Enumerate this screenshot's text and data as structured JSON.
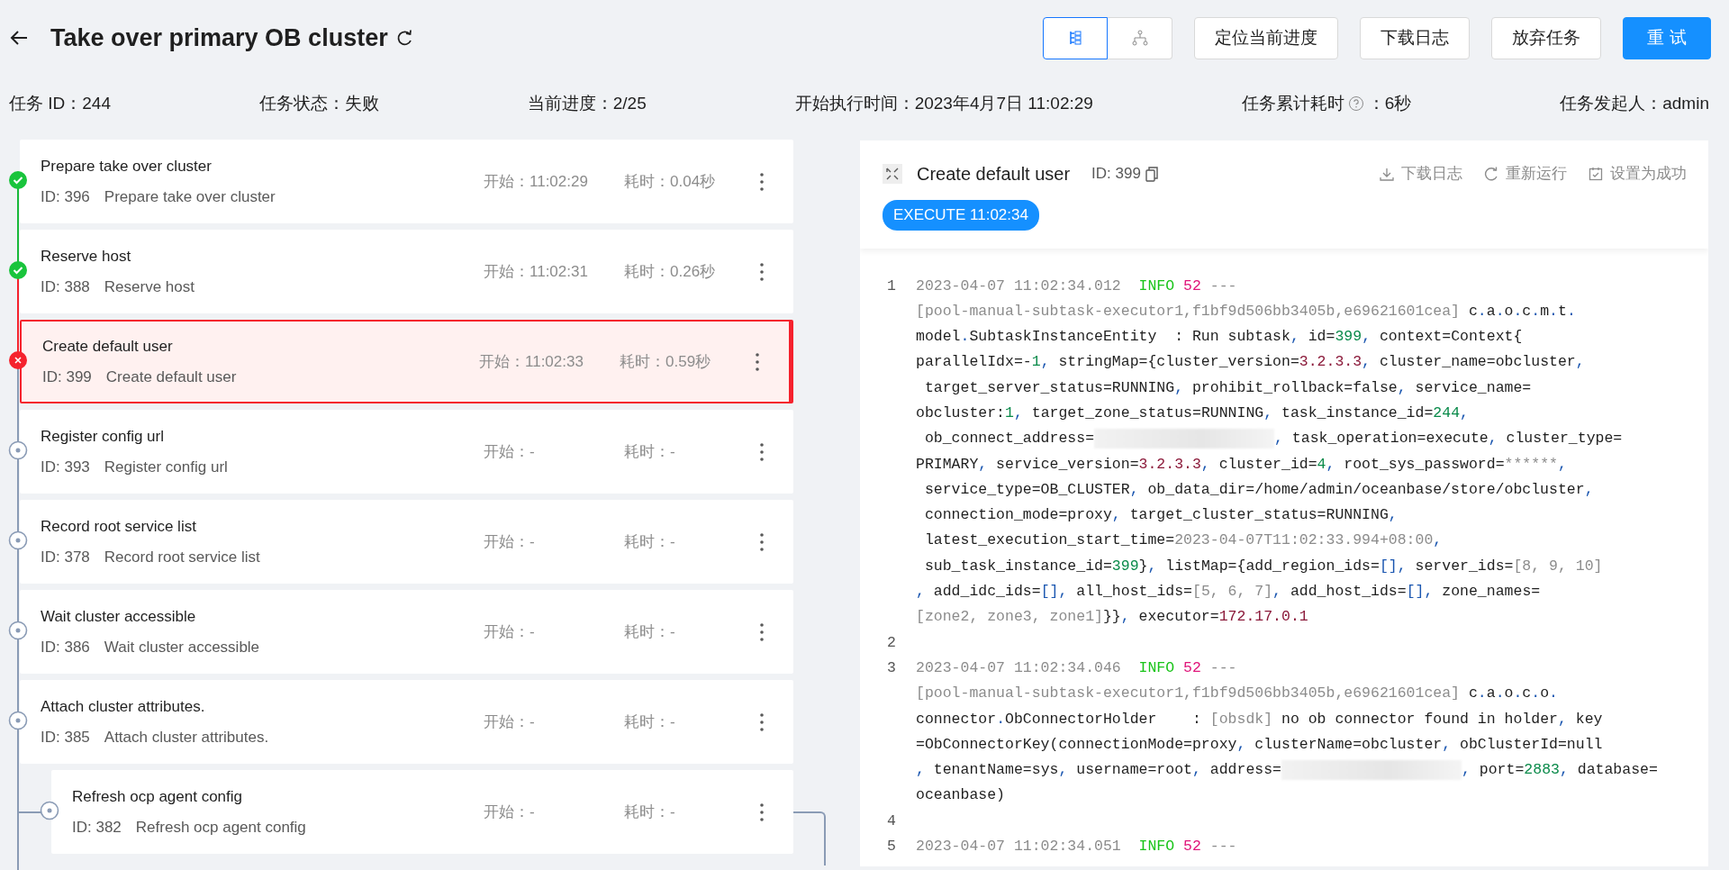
{
  "header": {
    "title": "Take over primary OB cluster",
    "view_toggle": [
      {
        "kind": "list",
        "selected": true
      },
      {
        "kind": "tree",
        "selected": false
      }
    ],
    "buttons": [
      {
        "label": "定位当前进度",
        "kind": "default"
      },
      {
        "label": "下载日志",
        "kind": "default"
      },
      {
        "label": "放弃任务",
        "kind": "default"
      },
      {
        "label": "重 试",
        "kind": "primary"
      }
    ]
  },
  "info": [
    {
      "text": "任务 ID：244",
      "help": false
    },
    {
      "text": "任务状态：失败",
      "help": false
    },
    {
      "text": "当前进度：2/25",
      "help": false
    },
    {
      "text": "开始执行时间：2023年4月7日 11:02:29",
      "help": false
    },
    {
      "text": "任务累计耗时",
      "help": true,
      "suffix": "：6秒"
    },
    {
      "text": "任务发起人：admin",
      "help": false
    }
  ],
  "tasks": [
    {
      "title": "Prepare take over cluster",
      "id": "ID: 396",
      "description": "Prepare take over cluster",
      "start": "开始：11:02:29",
      "duration": "耗时：0.04秒",
      "kind": "success",
      "selected": false
    },
    {
      "title": "Reserve host",
      "id": "ID: 388",
      "description": "Reserve host",
      "start": "开始：11:02:31",
      "duration": "耗时：0.26秒",
      "kind": "success",
      "selected": false
    },
    {
      "title": "Create default user",
      "id": "ID: 399",
      "description": "Create default user",
      "start": "开始：11:02:33",
      "duration": "耗时：0.59秒",
      "kind": "failed",
      "selected": true
    },
    {
      "title": "Register config url",
      "id": "ID: 393",
      "description": "Register config url",
      "start": "开始：-",
      "duration": "耗时：-",
      "kind": "pending",
      "selected": false
    },
    {
      "title": "Record root service list",
      "id": "ID: 378",
      "description": "Record root service list",
      "start": "开始：-",
      "duration": "耗时：-",
      "kind": "pending",
      "selected": false
    },
    {
      "title": "Wait cluster accessible",
      "id": "ID: 386",
      "description": "Wait cluster accessible",
      "start": "开始：-",
      "duration": "耗时：-",
      "kind": "pending",
      "selected": false
    },
    {
      "title": "Attach cluster attributes.",
      "id": "ID: 385",
      "description": "Attach cluster attributes.",
      "start": "开始：-",
      "duration": "耗时：-",
      "kind": "pending",
      "selected": false,
      "children": [
        {
          "title": "Refresh ocp agent config",
          "id": "ID: 382",
          "description": "Refresh ocp agent config",
          "start": "开始：-",
          "duration": "耗时：-",
          "kind": "pending",
          "selected": false
        }
      ]
    }
  ],
  "detail": {
    "title": "Create default user",
    "id": "ID: 399",
    "actions": [
      {
        "kind": "download",
        "label": "下载日志"
      },
      {
        "kind": "rerun",
        "label": "重新运行"
      },
      {
        "kind": "mark_success",
        "label": "设置为成功"
      }
    ],
    "badge": "EXECUTE 11:02:34",
    "log": [
      {
        "number": "1",
        "lines": [
          [
            {
              "kind": "muted",
              "text": "2023-04-07 11:02:34.012  "
            },
            {
              "kind": "level",
              "text": "INFO"
            },
            {
              "kind": "pid",
              "text": " 52"
            },
            {
              "kind": "muted",
              "text": " ---"
            }
          ],
          [
            {
              "kind": "muted",
              "text": "[pool-manual-subtask-executor1,f1bf9d506bb3405b,e69621601cea]"
            },
            {
              "kind": "plain",
              "text": " c.a.o.c.m.t."
            }
          ],
          [
            {
              "kind": "plain",
              "text": "model.SubtaskInstanceEntity  : Run subtask, id="
            },
            {
              "kind": "num",
              "text": "399"
            },
            {
              "kind": "plain",
              "text": ", context=Context{"
            }
          ],
          [
            {
              "kind": "plain",
              "text": "parallelIdx=-"
            },
            {
              "kind": "num",
              "text": "1"
            },
            {
              "kind": "plain",
              "text": ", stringMap={cluster_version="
            },
            {
              "kind": "str",
              "text": "3.2.3.3"
            },
            {
              "kind": "plain",
              "text": ", cluster_name=obcluster,"
            }
          ],
          [
            {
              "kind": "plain",
              "text": " target_server_status=RUNNING, prohibit_rollback=false, service_name="
            }
          ],
          [
            {
              "kind": "plain",
              "text": "obcluster:"
            },
            {
              "kind": "num",
              "text": "1"
            },
            {
              "kind": "plain",
              "text": ", target_zone_status=RUNNING, task_instance_id="
            },
            {
              "kind": "num",
              "text": "244"
            },
            {
              "kind": "plain",
              "text": ","
            }
          ],
          [
            {
              "kind": "plain",
              "text": " ob_connect_address="
            },
            {
              "kind": "redacted"
            },
            {
              "kind": "plain",
              "text": ", task_operation=execute, cluster_type="
            }
          ],
          [
            {
              "kind": "plain",
              "text": "PRIMARY, service_version="
            },
            {
              "kind": "str",
              "text": "3.2.3.3"
            },
            {
              "kind": "plain",
              "text": ", cluster_id="
            },
            {
              "kind": "num",
              "text": "4"
            },
            {
              "kind": "plain",
              "text": ", root_sys_password="
            },
            {
              "kind": "muted",
              "text": "******"
            },
            {
              "kind": "plain",
              "text": ","
            }
          ],
          [
            {
              "kind": "plain",
              "text": " service_type=OB_CLUSTER, ob_data_dir=/home/admin/oceanbase/store/obcluster,"
            }
          ],
          [
            {
              "kind": "plain",
              "text": " connection_mode=proxy, target_cluster_status=RUNNING,"
            }
          ],
          [
            {
              "kind": "plain",
              "text": " latest_execution_start_time="
            },
            {
              "kind": "muted",
              "text": "2023-04-07T11:02:33.994+08:00"
            },
            {
              "kind": "plain",
              "text": ","
            }
          ],
          [
            {
              "kind": "plain",
              "text": " sub_task_instance_id="
            },
            {
              "kind": "num",
              "text": "399"
            },
            {
              "kind": "plain",
              "text": "}, listMap={add_region_ids="
            },
            {
              "kind": "punct",
              "text": "[]"
            },
            {
              "kind": "plain",
              "text": ", server_ids="
            },
            {
              "kind": "muted",
              "text": "[8, 9, 10]"
            }
          ],
          [
            {
              "kind": "plain",
              "text": ", add_idc_ids="
            },
            {
              "kind": "punct",
              "text": "[]"
            },
            {
              "kind": "plain",
              "text": ", all_host_ids="
            },
            {
              "kind": "muted",
              "text": "[5, 6, 7]"
            },
            {
              "kind": "plain",
              "text": ", add_host_ids="
            },
            {
              "kind": "punct",
              "text": "[]"
            },
            {
              "kind": "plain",
              "text": ", zone_names="
            }
          ],
          [
            {
              "kind": "muted",
              "text": "[zone2, zone3, zone1]"
            },
            {
              "kind": "plain",
              "text": "}}, executor="
            },
            {
              "kind": "str",
              "text": "172.17.0.1"
            }
          ]
        ]
      },
      {
        "number": "2"
      },
      {
        "number": "3",
        "lines": [
          [
            {
              "kind": "muted",
              "text": "2023-04-07 11:02:34.046  "
            },
            {
              "kind": "level",
              "text": "INFO"
            },
            {
              "kind": "pid",
              "text": " 52"
            },
            {
              "kind": "muted",
              "text": " ---"
            }
          ],
          [
            {
              "kind": "muted",
              "text": "[pool-manual-subtask-executor1,f1bf9d506bb3405b,e69621601cea]"
            },
            {
              "kind": "plain",
              "text": " c.a.o.c.o."
            }
          ],
          [
            {
              "kind": "plain",
              "text": "connector.ObConnectorHolder    : "
            },
            {
              "kind": "muted",
              "text": "[obsdk]"
            },
            {
              "kind": "plain",
              "text": " no ob connector found in holder, key"
            }
          ],
          [
            {
              "kind": "plain",
              "text": "=ObConnectorKey(connectionMode=proxy, clusterName=obcluster, obClusterId=null"
            }
          ],
          [
            {
              "kind": "plain",
              "text": ", tenantName=sys, username=root, address="
            },
            {
              "kind": "redacted"
            },
            {
              "kind": "plain",
              "text": ", port="
            },
            {
              "kind": "num",
              "text": "2883"
            },
            {
              "kind": "plain",
              "text": ", database="
            }
          ],
          [
            {
              "kind": "plain",
              "text": "oceanbase)"
            }
          ]
        ]
      },
      {
        "number": "4"
      },
      {
        "number": "5",
        "lines": [
          [
            {
              "kind": "muted",
              "text": "2023-04-07 11:02:34.051  "
            },
            {
              "kind": "level",
              "text": "INFO"
            },
            {
              "kind": "pid",
              "text": " 52"
            },
            {
              "kind": "muted",
              "text": " ---"
            }
          ]
        ]
      }
    ]
  }
}
